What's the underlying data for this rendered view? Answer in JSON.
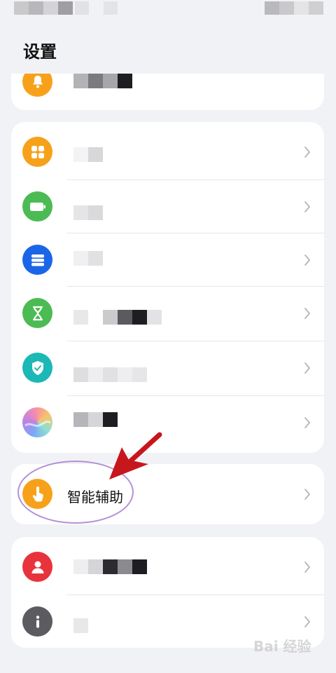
{
  "page": {
    "title": "设置"
  },
  "featured_item": {
    "label": "智能辅助"
  },
  "watermark": {
    "text": "Bai 经验"
  },
  "colors": {
    "background": "#f1f2f5",
    "notifications_icon": "#f7a11b",
    "apps_icon": "#f7a11b",
    "battery_icon": "#4cbb53",
    "storage_icon": "#1b66e8",
    "digital_balance_icon": "#4cbb53",
    "security_icon": "#1cb8b6",
    "assist_icon": "#f7a11b",
    "account_icon": "#e8333c",
    "about_icon": "#5c5c60",
    "annotation_ellipse": "#b490d6",
    "annotation_arrow": "#c8161d"
  },
  "icons": {
    "notifications": "bell-icon",
    "apps": "grid-icon",
    "battery": "battery-icon",
    "storage": "storage-icon",
    "digital_balance": "hourglass-icon",
    "security": "shield-icon",
    "theme": "wallpaper-icon",
    "assist": "hand-icon",
    "account": "person-icon",
    "about": "info-icon"
  }
}
